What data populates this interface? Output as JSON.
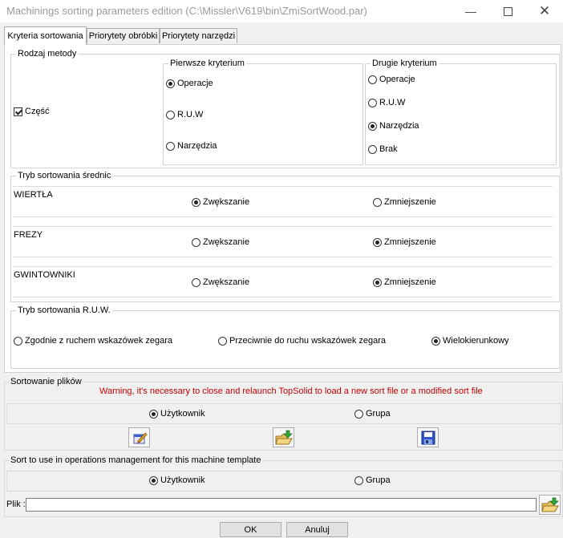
{
  "window": {
    "title": "Machinings sorting parameters edition (C:\\Missler\\V619\\bin\\ZmiSortWood.par)"
  },
  "tabs": [
    {
      "label": "Kryteria sortowania"
    },
    {
      "label": "Priorytety obróbki"
    },
    {
      "label": "Priorytety narzędzi"
    }
  ],
  "method": {
    "label": "Rodzaj metody",
    "part_checkbox": {
      "label": "Część",
      "checked": true
    },
    "first": {
      "label": "Pierwsze kryterium",
      "options": [
        "Operacje",
        "R.U.W",
        "Narzędzia"
      ],
      "selected": 0
    },
    "second": {
      "label": "Drugie kryterium",
      "options": [
        "Operacje",
        "R.U.W",
        "Narzędzia",
        "Brak"
      ],
      "selected": 2
    }
  },
  "diam": {
    "label": "Tryb sortowania średnic",
    "rows": [
      {
        "name": "WIERTŁA",
        "inc": "Zwększanie",
        "dec": "Zmniejszenie",
        "selected": "inc"
      },
      {
        "name": "FREZY",
        "inc": "Zwększanie",
        "dec": "Zmniejszenie",
        "selected": "dec"
      },
      {
        "name": "GWINTOWNIKI",
        "inc": "Zwększanie",
        "dec": "Zmniejszenie",
        "selected": "dec"
      }
    ]
  },
  "ruw": {
    "label": "Tryb sortowania R.U.W.",
    "options": [
      "Zgodnie z ruchem wskazówek zegara",
      "Przeciwnie do ruchu wskazówek zegara",
      "Wielokierunkowy"
    ],
    "selected": 2
  },
  "files": {
    "label": "Sortowanie plików",
    "warning": "Warning, it's necessary to close and relaunch TopSolid to load a new sort file or a modified sort file",
    "options": [
      "Użytkownik",
      "Grupa"
    ],
    "selected": 0,
    "icons": [
      "edit-file-icon",
      "open-folder-icon",
      "save-disk-icon"
    ]
  },
  "ops": {
    "label": "Sort to use in operations management for this machine template",
    "options": [
      "Użytkownik",
      "Grupa"
    ],
    "selected": 0,
    "file_label": "Plik :",
    "file_value": ""
  },
  "buttons": {
    "ok": "OK",
    "cancel": "Anuluj"
  }
}
